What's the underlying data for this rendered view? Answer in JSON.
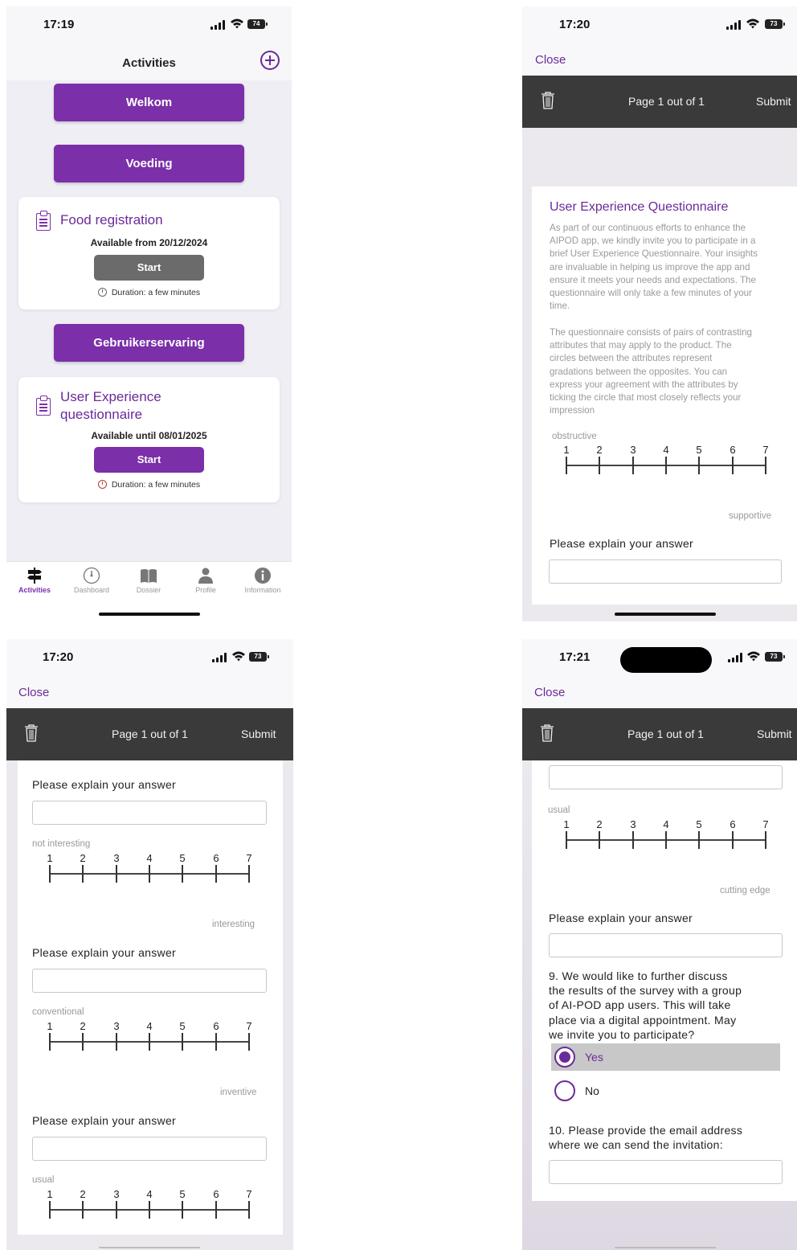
{
  "screen1": {
    "time": "17:19",
    "battery": "74",
    "nav_title": "Activities",
    "buttons": [
      "Welkom",
      "Voeding",
      "Gebruikerservaring"
    ],
    "cards": [
      {
        "title_lines": [
          "Food registration"
        ],
        "availability": "Available from 20/12/2024",
        "start": "Start",
        "duration": "Duration: a few minutes",
        "start_color": "#6b6b6b"
      },
      {
        "title_lines": [
          "User Experience",
          "questionnaire"
        ],
        "availability": "Available until 08/01/2025",
        "start": "Start",
        "duration": "Duration: a few minutes",
        "start_color": "#7b2fa8"
      }
    ],
    "tabs": [
      {
        "label": "Activities",
        "icon": "signpost-icon",
        "active": true
      },
      {
        "label": "Dashboard",
        "icon": "gauge-icon",
        "active": false
      },
      {
        "label": "Dossier",
        "icon": "book-icon",
        "active": false
      },
      {
        "label": "Profile",
        "icon": "person-icon",
        "active": false
      },
      {
        "label": "Information",
        "icon": "info-icon",
        "active": false
      }
    ]
  },
  "questionnaire": {
    "close": "Close",
    "page_info": "Page 1 out of 1",
    "submit": "Submit",
    "title": "User Experience Questionnaire",
    "intro_lines_1": [
      "As part of our continuous efforts to enhance the",
      "AIPOD app, we kindly invite you to participate in a",
      "brief User Experience Questionnaire. Your insights",
      "are invaluable in helping us improve the app and",
      "ensure it meets your needs and expectations. The",
      "questionnaire will only take a few minutes of your",
      "time."
    ],
    "intro_lines_2": [
      "The questionnaire consists of pairs of contrasting",
      "attributes that may apply to the product. The",
      "circles between the attributes represent",
      "gradations between the opposites. You can",
      "express your agreement with the attributes by",
      "ticking the circle that most closely reflects your",
      "impression"
    ],
    "scale_numbers": [
      "1",
      "2",
      "3",
      "4",
      "5",
      "6",
      "7"
    ],
    "explain": "Please explain your answer",
    "pairs": [
      {
        "left": "obstructive",
        "right": "supportive"
      },
      {
        "left": "not interesting",
        "right": "interesting"
      },
      {
        "left": "conventional",
        "right": "inventive"
      },
      {
        "left": "usual",
        "right": "cutting edge"
      }
    ],
    "q9_lines": [
      "9. We would like to further discuss",
      "the results of the survey with a group",
      "of AI-POD app users. This will take",
      "place via a digital appointment. May",
      "we invite you to participate?"
    ],
    "q9_options": [
      "Yes",
      "No"
    ],
    "q9_selected": "Yes",
    "q10_lines": [
      "10.  Please provide the email address",
      "where we can send the invitation:"
    ]
  },
  "screen2": {
    "time": "17:20",
    "battery": "73"
  },
  "screen3": {
    "time": "17:20",
    "battery": "73"
  },
  "screen4": {
    "time": "17:21",
    "battery": "73"
  },
  "colors": {
    "brand_purple": "#7b2fa8",
    "dark_bar": "#3a3a3a"
  }
}
